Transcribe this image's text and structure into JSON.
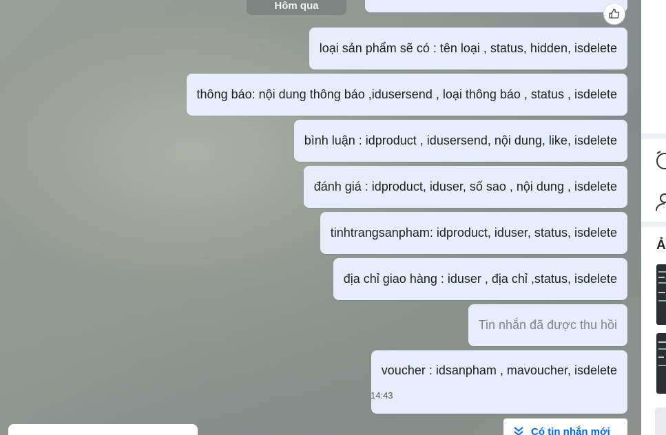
{
  "chat": {
    "date_separator": "Hôm qua",
    "messages": [
      {
        "text": "loại sản phẩm sẽ có : tên loại , status, hidden, isdelete"
      },
      {
        "text": "thông báo: nội dung thông báo ,idusersend , loại thông báo , status , isdelete"
      },
      {
        "text": "bình luận : idproduct , idusersend, nội dung, like, isdelete"
      },
      {
        "text": "đánh giá : idproduct, iduser, số sao , nội dung , isdelete"
      },
      {
        "text": "tinhtrangsanpham: idproduct, iduser, status, isdelete"
      },
      {
        "text": "địa chỉ giao hàng : iduser , địa chỉ ,status, isdelete"
      },
      {
        "text": "Tin nhắn đã được thu hồi",
        "recalled": true
      },
      {
        "text": "voucher : idsanpham , mavoucher, isdelete",
        "time": "14:43"
      }
    ],
    "new_messages_label": "Có tin nhắn mới",
    "accent_color": "#0068ff",
    "bubble_color": "#e6eefb"
  },
  "right_panel": {
    "section_header_partial": "Ả",
    "icons": [
      "alarm-icon",
      "user-icon"
    ]
  }
}
